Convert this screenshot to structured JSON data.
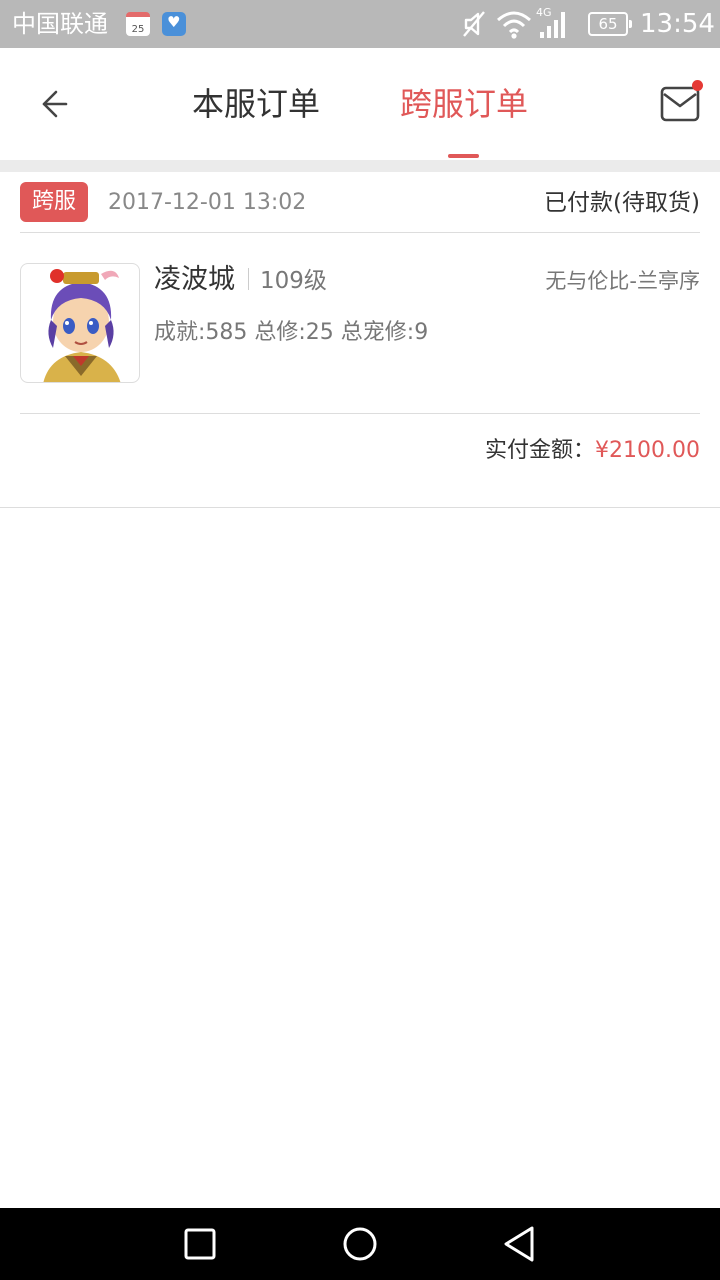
{
  "status_bar": {
    "carrier": "中国联通",
    "calendar_day": "25",
    "network_type": "4G",
    "battery_level": "65",
    "time": "13:54",
    "icons": [
      "calendar-icon",
      "health-icon",
      "mute-icon",
      "wifi-icon",
      "signal-icon",
      "battery-icon"
    ]
  },
  "header": {
    "tabs": [
      {
        "label": "本服订单",
        "active": false
      },
      {
        "label": "跨服订单",
        "active": true
      }
    ],
    "back_icon": "arrow-left-icon",
    "mail_icon": "mail-icon",
    "mail_has_notification": true
  },
  "order": {
    "badge": "跨服",
    "time": "2017-12-01 13:02",
    "status": "已付款(待取货)",
    "character": {
      "name": "凌波城",
      "level": "109级",
      "server": "无与伦比-兰亭序",
      "stats": "成就:585 总修:25 总宠修:9"
    },
    "amount_label": "实付金额：",
    "amount_value": "¥2100.00"
  },
  "colors": {
    "accent": "#e05858",
    "status_bar": "#b8b8b8",
    "divider": "#dddddd",
    "gap": "#ebebeb",
    "nav_bar": "#000000"
  },
  "nav_bar": {
    "icons": [
      "recent-apps-icon",
      "home-icon",
      "back-triangle-icon"
    ]
  }
}
